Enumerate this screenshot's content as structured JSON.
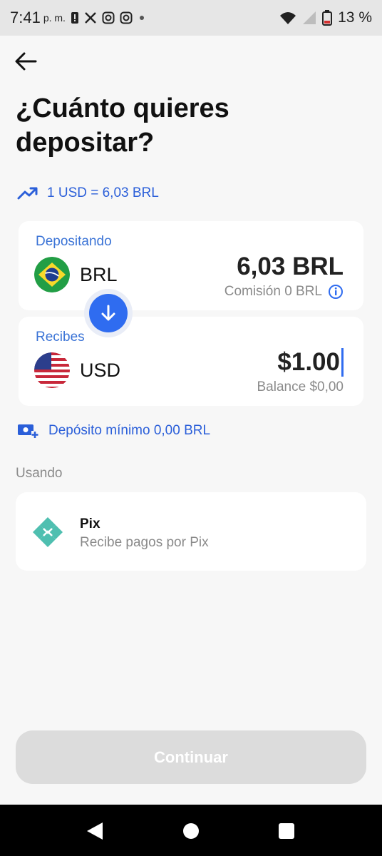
{
  "status_bar": {
    "time": "7:41",
    "ampm": "p. m.",
    "battery": "13 %"
  },
  "header": {
    "title": "¿Cuánto quieres depositar?"
  },
  "rate": {
    "text": "1 USD = 6,03 BRL"
  },
  "deposit_card": {
    "label": "Depositando",
    "currency": "BRL",
    "amount": "6,03 BRL",
    "fee": "Comisión 0 BRL"
  },
  "receive_card": {
    "label": "Recibes",
    "currency": "USD",
    "amount": "$1.00",
    "balance": "Balance $0,00"
  },
  "minimum": {
    "text": "Depósito mínimo 0,00 BRL"
  },
  "payment": {
    "section_label": "Usando",
    "method_name": "Pix",
    "method_desc": "Recibe pagos por Pix"
  },
  "actions": {
    "continue_label": "Continuar"
  },
  "colors": {
    "accent": "#2f6cf0",
    "link": "#2b5fd9",
    "pix": "#4fbfb0"
  },
  "icons": [
    "back-arrow-icon",
    "trend-up-icon",
    "info-icon",
    "swap-down-arrow-icon",
    "cash-plus-icon",
    "pix-icon"
  ]
}
